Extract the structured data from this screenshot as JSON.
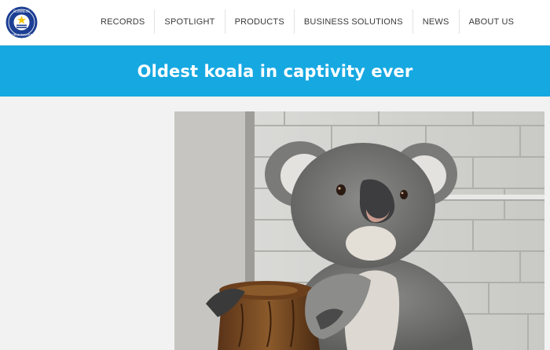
{
  "header": {
    "logo_text": "GUINNESS WORLD RECORDS",
    "nav": [
      {
        "label": "RECORDS"
      },
      {
        "label": "SPOTLIGHT"
      },
      {
        "label": "PRODUCTS"
      },
      {
        "label": "BUSINESS SOLUTIONS"
      },
      {
        "label": "NEWS"
      },
      {
        "label": "ABOUT US"
      }
    ]
  },
  "banner": {
    "title": "Oldest koala in captivity ever"
  },
  "colors": {
    "banner": "#16a8e1",
    "logo_blue": "#1c3f94",
    "logo_gold": "#f5c400"
  }
}
